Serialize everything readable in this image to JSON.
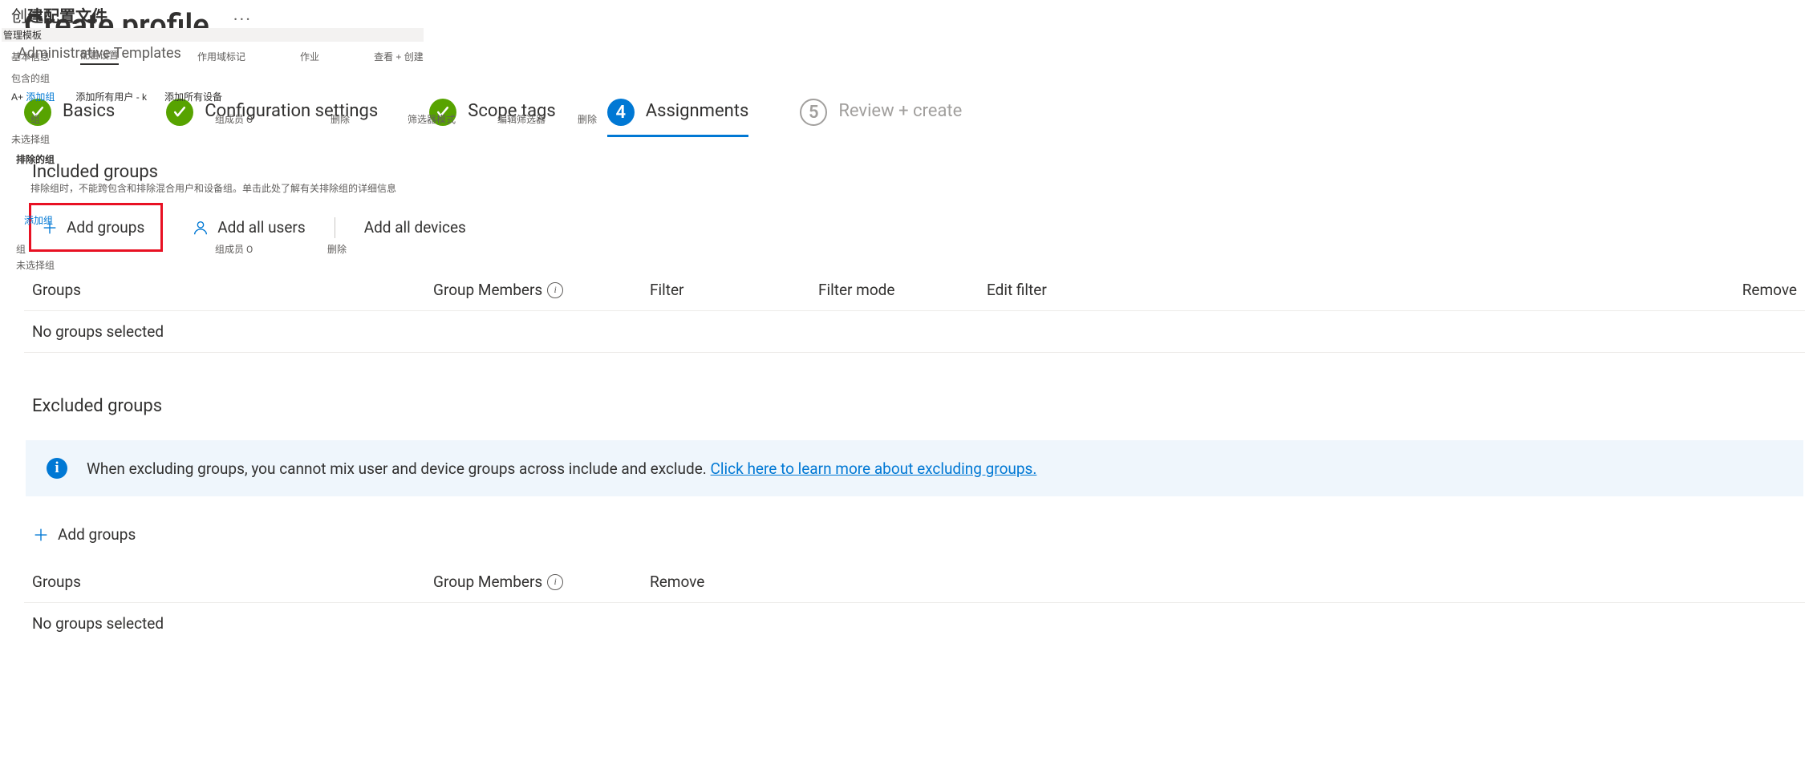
{
  "header": {
    "title": "Create profile",
    "title_prefix_overlay": "创",
    "title_prefix_overlay2": "建配置文件",
    "subtitle": "Administrative Templates",
    "ellipsis": "···"
  },
  "overlay": {
    "template": "管理模板",
    "tabs": [
      "基本信息",
      "配置设置",
      "作用域标记",
      "作业",
      "查看 + 创建"
    ],
    "sec_included": "包含的组",
    "row_prefix": "A+",
    "row_prefix2": "添加组",
    "add_all_users": "添加所有用户 - k",
    "add_all_devices": "添加所有设备",
    "not_selected": "未选择组",
    "col_group": "组",
    "col_members": "组成员 ⓘ",
    "col_filter": "筛选器模式",
    "col_editfilter": "编辑筛选器",
    "col_remove": "删除",
    "excluded_title": "排除的组",
    "exclude_note": "排除组时，不能跨包含和排除混合用户和设备组。单击此处了解有关排除组的详细信息",
    "add_groups_cn": "添加组",
    "members0": "组成员 O",
    "delete_cn": "删除",
    "not_selected2": "未选择组"
  },
  "steps": [
    {
      "label": "Basics",
      "state": "done",
      "number": ""
    },
    {
      "label": "Configuration settings",
      "state": "done",
      "number": ""
    },
    {
      "label": "Scope tags",
      "state": "done",
      "number": ""
    },
    {
      "label": "Assignments",
      "state": "current",
      "number": "4"
    },
    {
      "label": "Review + create",
      "state": "todo",
      "number": "5"
    }
  ],
  "included": {
    "title": "Included groups",
    "actions": {
      "add_groups": "Add groups",
      "add_all_users": "Add all users",
      "add_all_devices": "Add all devices"
    },
    "columns": [
      "Groups",
      "Group Members",
      "Filter",
      "Filter mode",
      "Edit filter",
      "Remove"
    ],
    "empty": "No groups selected"
  },
  "excluded": {
    "title": "Excluded groups",
    "banner_text": "When excluding groups, you cannot mix user and device groups across include and exclude. ",
    "banner_link": "Click here to learn more about excluding groups.",
    "add_groups": "Add groups",
    "columns": [
      "Groups",
      "Group Members",
      "Remove"
    ],
    "empty": "No groups selected"
  }
}
